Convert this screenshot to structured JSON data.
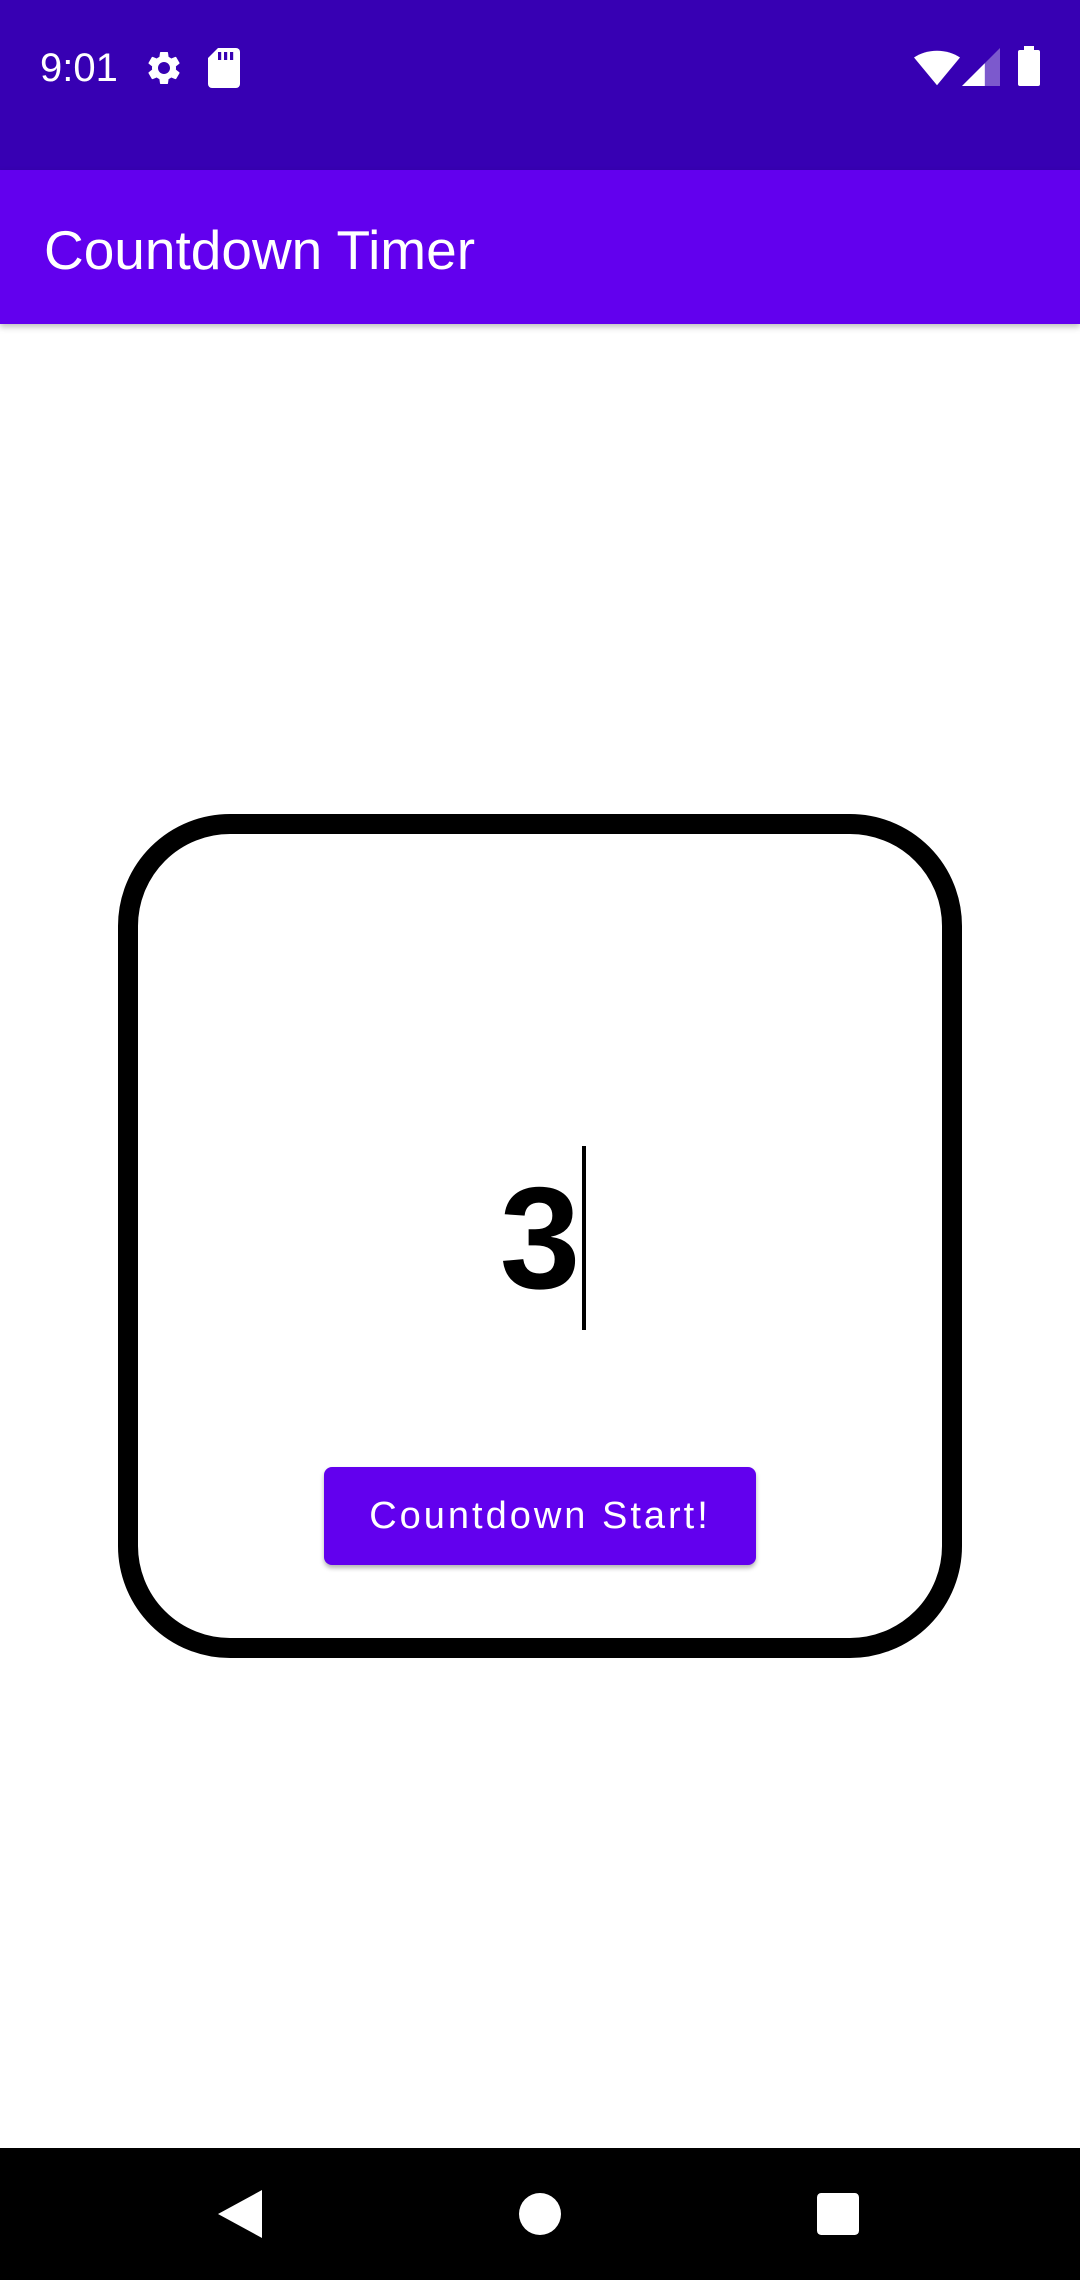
{
  "status_bar": {
    "time": "9:01",
    "icons": [
      "gear-icon",
      "sd-card-icon",
      "wifi-icon",
      "cell-signal-icon",
      "battery-icon"
    ]
  },
  "app_bar": {
    "title": "Countdown Timer"
  },
  "timer": {
    "count_value": "3",
    "start_button_label": "Countdown Start!"
  },
  "nav_bar": {
    "buttons": [
      "back-icon",
      "home-icon",
      "recents-icon"
    ]
  },
  "colors": {
    "status_bar": "#3700b3",
    "primary": "#6200ee",
    "frame": "#000000",
    "background": "#ffffff"
  }
}
